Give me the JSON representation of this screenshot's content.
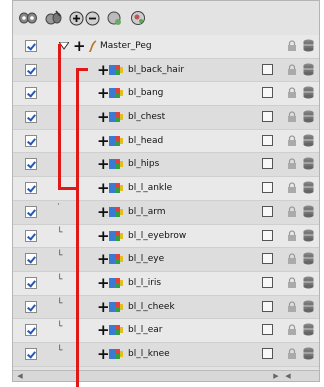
{
  "toolbar": {
    "buttons": [
      {
        "name": "show-all-icon"
      },
      {
        "name": "hide-all-icon"
      },
      {
        "name": "add-layer-icon"
      },
      {
        "name": "remove-layer-icon"
      },
      {
        "name": "add-peg-icon"
      },
      {
        "name": "add-drawing-icon"
      }
    ]
  },
  "layers": [
    {
      "label": "Master_Peg",
      "type": "peg",
      "checked": true
    },
    {
      "label": "bl_back_hair",
      "type": "drawing",
      "checked": true
    },
    {
      "label": "bl_bang",
      "type": "drawing",
      "checked": true
    },
    {
      "label": "bl_chest",
      "type": "drawing",
      "checked": true
    },
    {
      "label": "bl_head",
      "type": "drawing",
      "checked": true
    },
    {
      "label": "bl_hips",
      "type": "drawing",
      "checked": true
    },
    {
      "label": "bl_l_ankle",
      "type": "drawing",
      "checked": true
    },
    {
      "label": "bl_l_arm",
      "type": "drawing",
      "checked": true
    },
    {
      "label": "bl_l_eyebrow",
      "type": "drawing",
      "checked": true
    },
    {
      "label": "bl_l_eye",
      "type": "drawing",
      "checked": true
    },
    {
      "label": "bl_l_iris",
      "type": "drawing",
      "checked": true
    },
    {
      "label": "bl_l_cheek",
      "type": "drawing",
      "checked": true
    },
    {
      "label": "bl_l_ear",
      "type": "drawing",
      "checked": true
    },
    {
      "label": "bl_l_knee",
      "type": "drawing",
      "checked": true
    }
  ],
  "colors": {
    "annotation": "#e01818",
    "checkmark": "#2458b8"
  }
}
